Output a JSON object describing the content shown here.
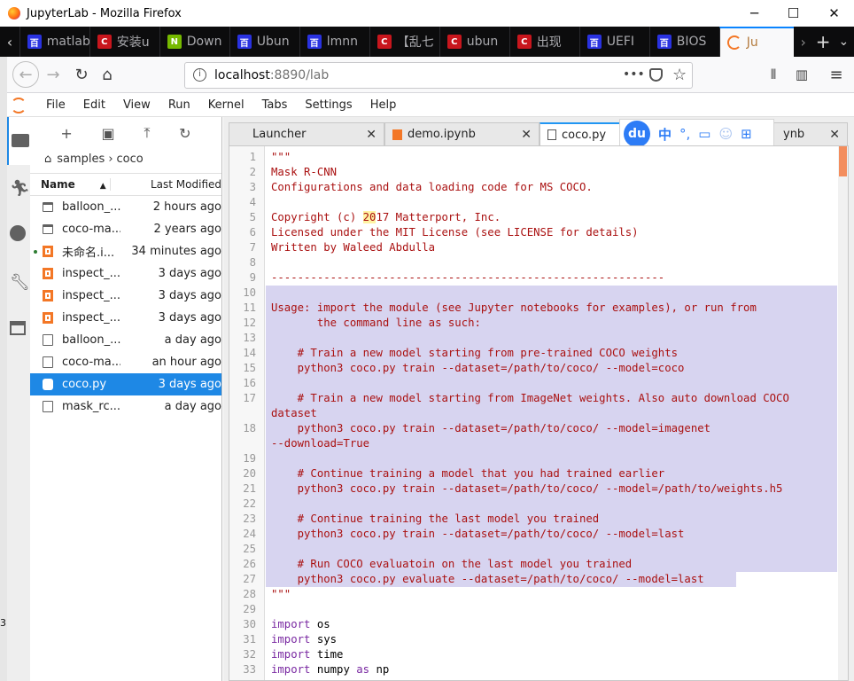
{
  "window": {
    "title": "JupyterLab - Mozilla Firefox",
    "minimize": "─",
    "maximize": "☐",
    "close": "✕"
  },
  "browser_tabs": [
    {
      "label": "matlab",
      "icon_color": "#2932e1",
      "icon": "百"
    },
    {
      "label": "安装u",
      "icon_color": "#c8161d",
      "icon": "C"
    },
    {
      "label": "Down",
      "icon_color": "#76b900",
      "icon": "N"
    },
    {
      "label": "Ubun",
      "icon_color": "#2932e1",
      "icon": "百"
    },
    {
      "label": "lmnn",
      "icon_color": "#2932e1",
      "icon": "百"
    },
    {
      "label": "【乱七",
      "icon_color": "#c8161d",
      "icon": "C"
    },
    {
      "label": "ubun",
      "icon_color": "#c8161d",
      "icon": "C"
    },
    {
      "label": "出现",
      "icon_color": "#c8161d",
      "icon": "C"
    },
    {
      "label": "UEFI",
      "icon_color": "#2932e1",
      "icon": "百"
    },
    {
      "label": "BIOS",
      "icon_color": "#2932e1",
      "icon": "百"
    },
    {
      "label": "Ju",
      "icon_color": "#f37726",
      "icon": ""
    }
  ],
  "url": {
    "host": "localhost",
    "rest": ":8890/lab"
  },
  "menu": [
    "File",
    "Edit",
    "View",
    "Run",
    "Kernel",
    "Tabs",
    "Settings",
    "Help"
  ],
  "filebrowser": {
    "breadcrumb_root": "samples",
    "breadcrumb_sep": "›",
    "breadcrumb_current": "coco",
    "header_name": "Name",
    "header_modified": "Last Modified",
    "files": [
      {
        "name": "balloon_...",
        "modified": "2 hours ago",
        "type": "folder",
        "running": false,
        "selected": false
      },
      {
        "name": "coco-ma...",
        "modified": "2 years ago",
        "type": "folder",
        "running": false,
        "selected": false
      },
      {
        "name": "未命名.i...",
        "modified": "34 minutes ago",
        "type": "notebook",
        "running": true,
        "selected": false
      },
      {
        "name": "inspect_...",
        "modified": "3 days ago",
        "type": "notebook",
        "running": false,
        "selected": false
      },
      {
        "name": "inspect_...",
        "modified": "3 days ago",
        "type": "notebook",
        "running": false,
        "selected": false
      },
      {
        "name": "inspect_...",
        "modified": "3 days ago",
        "type": "notebook",
        "running": false,
        "selected": false
      },
      {
        "name": "balloon_...",
        "modified": "a day ago",
        "type": "file",
        "running": false,
        "selected": false
      },
      {
        "name": "coco-ma...",
        "modified": "an hour ago",
        "type": "file",
        "running": false,
        "selected": false
      },
      {
        "name": "coco.py",
        "modified": "3 days ago",
        "type": "python",
        "running": false,
        "selected": true
      },
      {
        "name": "mask_rc...",
        "modified": "a day ago",
        "type": "file",
        "running": false,
        "selected": false
      }
    ]
  },
  "doc_tabs": [
    {
      "label": "Launcher",
      "close": "✕"
    },
    {
      "label": "demo.ipynb",
      "close": "✕"
    },
    {
      "label": "coco.py",
      "close": "✕"
    },
    {
      "label": "ynb",
      "close": "✕"
    }
  ],
  "ime": {
    "logo": "du",
    "lang": "中",
    "punct": "°,"
  },
  "code_lines": [
    {
      "n": "1",
      "text": "\"\"\""
    },
    {
      "n": "2",
      "text": "Mask R-CNN"
    },
    {
      "n": "3",
      "text": "Configurations and data loading code for MS COCO."
    },
    {
      "n": "4",
      "text": ""
    },
    {
      "n": "5",
      "text": "Copyright (c) 2017 Matterport, Inc."
    },
    {
      "n": "6",
      "text": "Licensed under the MIT License (see LICENSE for details)"
    },
    {
      "n": "7",
      "text": "Written by Waleed Abdulla"
    },
    {
      "n": "8",
      "text": ""
    },
    {
      "n": "9",
      "text": "------------------------------------------------------------"
    },
    {
      "n": "10",
      "text": ""
    },
    {
      "n": "11",
      "text": "Usage: import the module (see Jupyter notebooks for examples), or run from"
    },
    {
      "n": "12",
      "text": "       the command line as such:"
    },
    {
      "n": "13",
      "text": ""
    },
    {
      "n": "14",
      "text": "    # Train a new model starting from pre-trained COCO weights"
    },
    {
      "n": "15",
      "text": "    python3 coco.py train --dataset=/path/to/coco/ --model=coco"
    },
    {
      "n": "16",
      "text": ""
    },
    {
      "n": "17",
      "text": "    # Train a new model starting from ImageNet weights. Also auto download COCO"
    },
    {
      "n": "",
      "text": "dataset"
    },
    {
      "n": "18",
      "text": "    python3 coco.py train --dataset=/path/to/coco/ --model=imagenet"
    },
    {
      "n": "",
      "text": "--download=True"
    },
    {
      "n": "19",
      "text": ""
    },
    {
      "n": "20",
      "text": "    # Continue training a model that you had trained earlier"
    },
    {
      "n": "21",
      "text": "    python3 coco.py train --dataset=/path/to/coco/ --model=/path/to/weights.h5"
    },
    {
      "n": "22",
      "text": ""
    },
    {
      "n": "23",
      "text": "    # Continue training the last model you trained"
    },
    {
      "n": "24",
      "text": "    python3 coco.py train --dataset=/path/to/coco/ --model=last"
    },
    {
      "n": "25",
      "text": ""
    },
    {
      "n": "26",
      "text": "    # Run COCO evaluatoin on the last model you trained"
    },
    {
      "n": "27",
      "text": "    python3 coco.py evaluate --dataset=/path/to/coco/ --model=last"
    },
    {
      "n": "28",
      "text": "\"\"\""
    },
    {
      "n": "29",
      "text": ""
    },
    {
      "n": "30",
      "kw": "import",
      "rest": " os"
    },
    {
      "n": "31",
      "kw": "import",
      "rest": " sys"
    },
    {
      "n": "32",
      "kw": "import",
      "rest": " time"
    },
    {
      "n": "33",
      "kw": "import",
      "rest": " numpy ",
      "kw2": "as",
      "rest2": " np"
    }
  ],
  "left_edge_text": "3"
}
